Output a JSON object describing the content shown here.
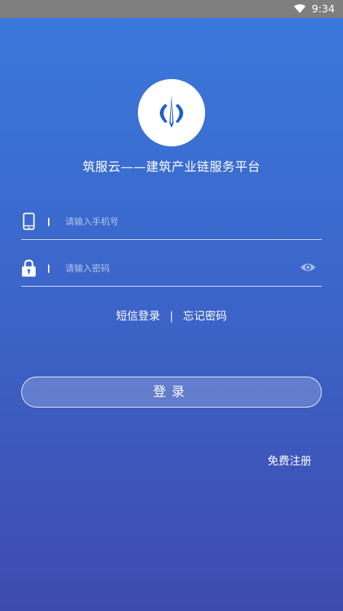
{
  "status_bar": {
    "time": "9:34",
    "icons": [
      "wifi-icon"
    ]
  },
  "logo": {
    "icon": "app-logo-icon",
    "colors": {
      "circle": "#ffffff",
      "mark": "#1e5fd0"
    }
  },
  "app_title": "筑服云——建筑产业链服务平台",
  "form": {
    "phone": {
      "icon": "phone-icon",
      "placeholder": "请输入手机号",
      "value": ""
    },
    "password": {
      "icon": "lock-icon",
      "placeholder": "请输入密码",
      "value": "",
      "toggle_icon": "eye-icon"
    }
  },
  "links": {
    "sms_login": "短信登录",
    "separator": "|",
    "forgot_password": "忘记密码"
  },
  "login_button": "登录",
  "register_link": "免费注册",
  "colors": {
    "background_top": "#3a79dc",
    "background_bottom": "#3e4aae",
    "status_bar": "#7f7f7f",
    "text": "#ffffff"
  }
}
